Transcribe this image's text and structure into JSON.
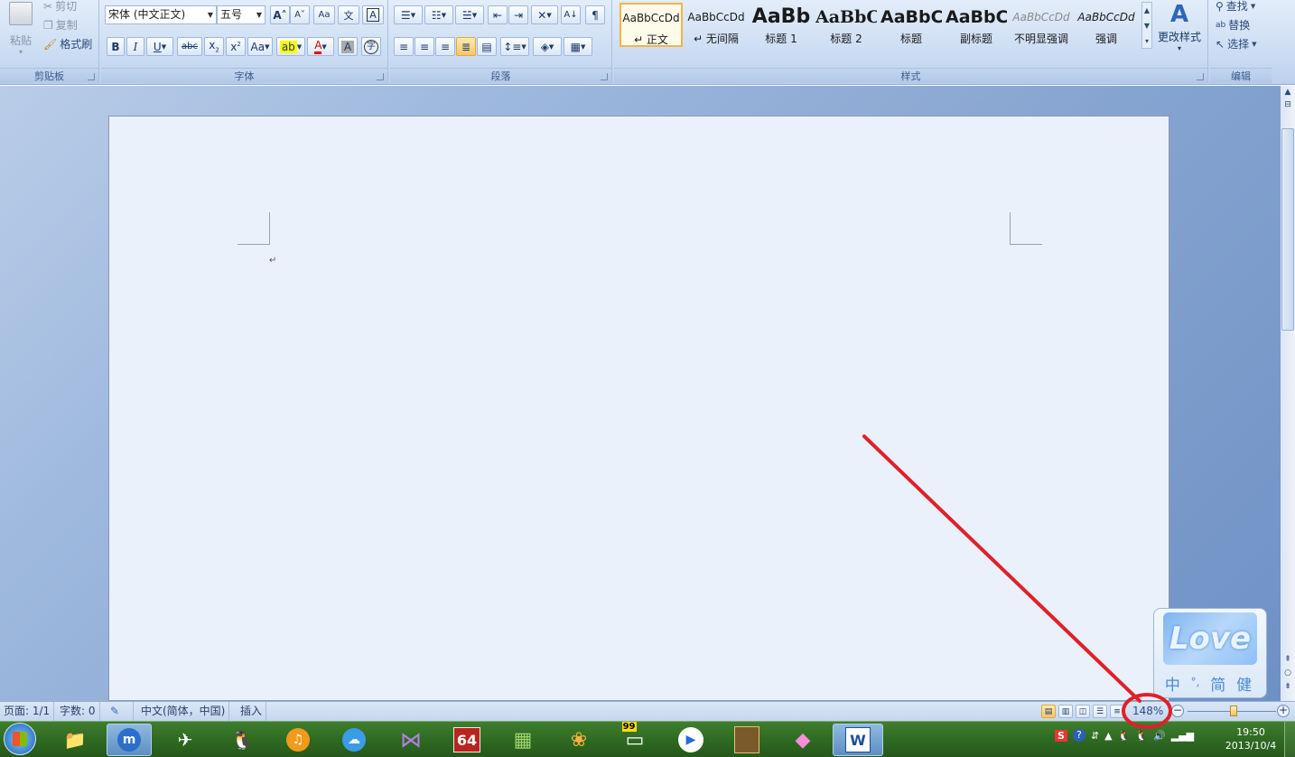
{
  "ribbon": {
    "clipboard": {
      "paste": "粘贴",
      "cut": "剪切",
      "copy": "复制",
      "format_painter": "格式刷",
      "label": "剪贴板"
    },
    "font": {
      "font_name": "宋体 (中文正文)",
      "font_size": "五号",
      "label": "字体"
    },
    "paragraph": {
      "label": "段落"
    },
    "styles": {
      "label": "样式",
      "change_styles": "更改样式",
      "items": [
        {
          "preview": "AaBbCcDd",
          "name": "↵ 正文"
        },
        {
          "preview": "AaBbCcDd",
          "name": "↵ 无间隔"
        },
        {
          "preview": "AaBb",
          "name": "标题 1"
        },
        {
          "preview": "AaBbC",
          "name": "标题 2"
        },
        {
          "preview": "AaBbC",
          "name": "标题"
        },
        {
          "preview": "AaBbC",
          "name": "副标题"
        },
        {
          "preview": "AaBbCcDd",
          "name": "不明显强调"
        },
        {
          "preview": "AaBbCcDd",
          "name": "强调"
        }
      ]
    },
    "editing": {
      "find": "查找",
      "replace": "替换",
      "select": "选择",
      "label": "编辑"
    }
  },
  "document": {
    "paragraph_mark": "↵"
  },
  "status": {
    "page": "页面: 1/1",
    "words": "字数: 0",
    "language": "中文(简体，中国)",
    "mode": "插入",
    "zoom": "148%"
  },
  "ime": {
    "logo": "Love",
    "chars": [
      "中",
      "°,",
      "简",
      "健"
    ]
  },
  "taskbar": {
    "time": "19:50",
    "date": "2013/10/4",
    "badge_64": "64",
    "badge_99": "99"
  },
  "colors": {
    "accent": "#f3b44a",
    "annotation": "#e0202a",
    "taskbar": "#2f6a22"
  }
}
